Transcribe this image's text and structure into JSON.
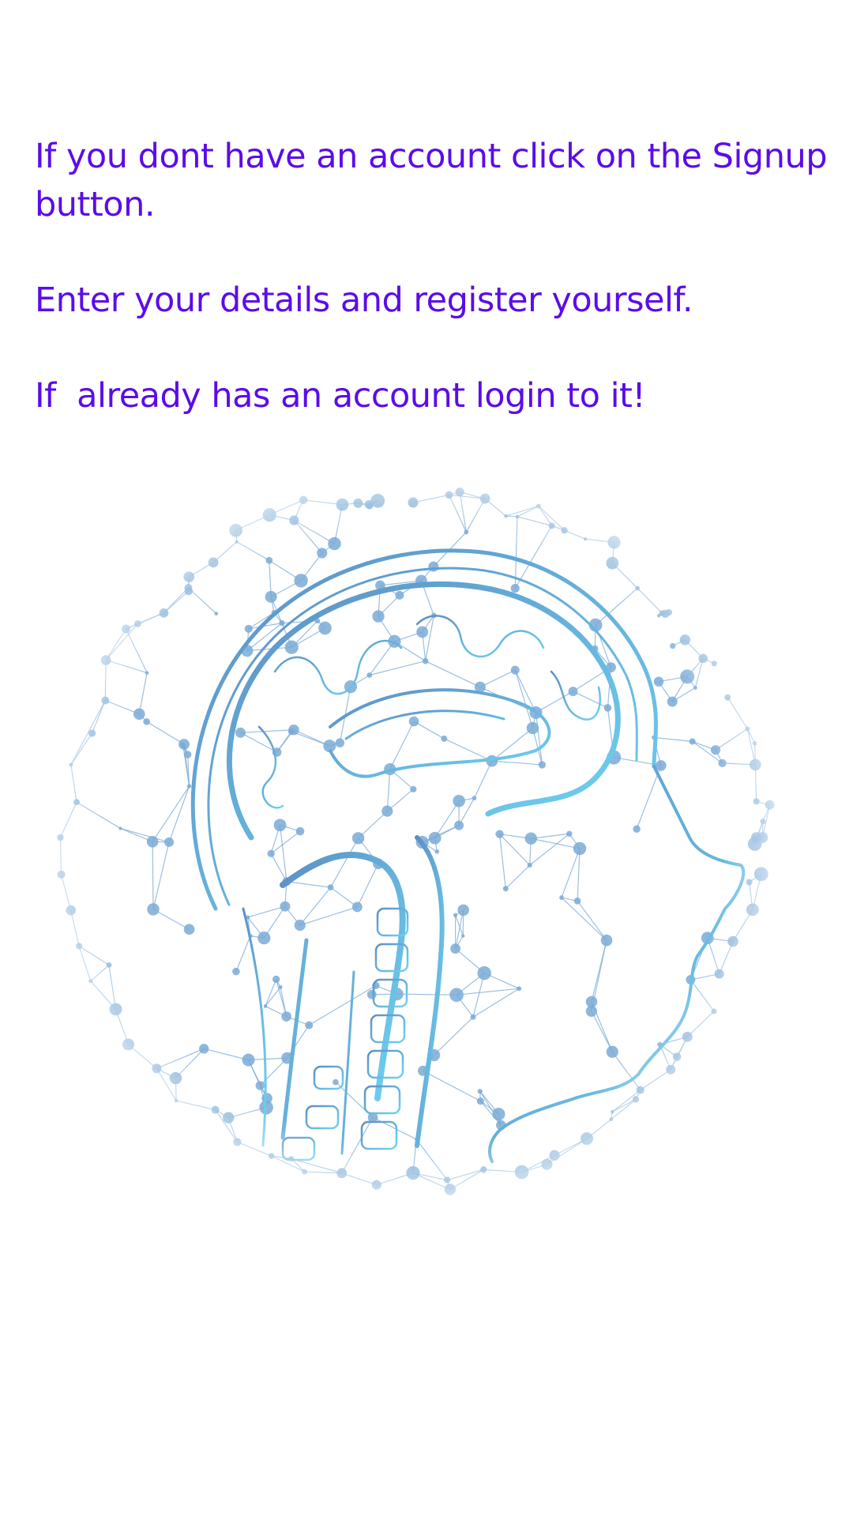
{
  "instructions": {
    "line1": "If you dont have an account click on the Signup button.",
    "line2": "Enter your details and register yourself.",
    "line3": "If  already has an account login to it!"
  },
  "colors": {
    "text": "#5b0ce8",
    "network": "#7aaad6",
    "brain_dark": "#5c8fc4",
    "brain_light": "#6fd3f2",
    "background": "#ffffff"
  },
  "illustration": {
    "icon": "brain-network-icon"
  }
}
